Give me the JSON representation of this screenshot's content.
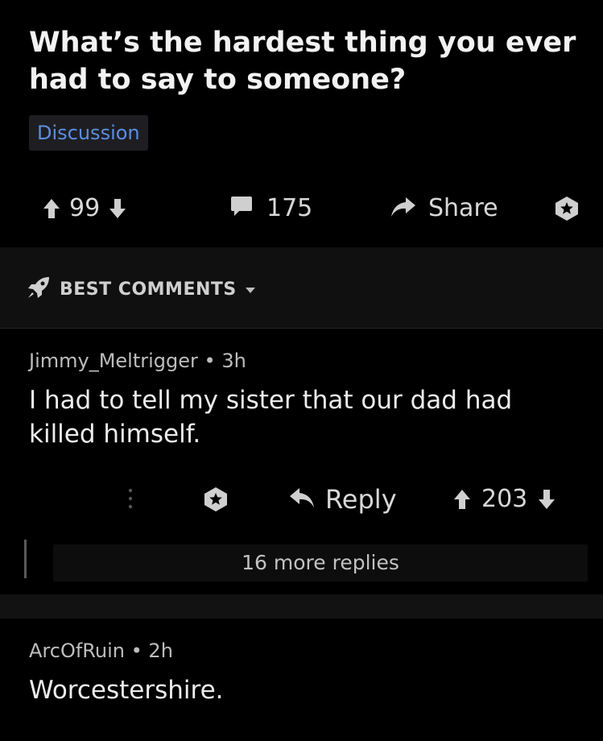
{
  "post": {
    "title": "What’s the hardest thing you ever had to say to someone?",
    "flair": "Discussion",
    "score": "99",
    "comment_count": "175",
    "share_label": "Share"
  },
  "sort": {
    "label": "BEST COMMENTS"
  },
  "comments": [
    {
      "author": "Jimmy_Meltrigger",
      "separator": "•",
      "age": "3h",
      "body": "I had to tell my sister that our dad had killed himself.",
      "reply_label": "Reply",
      "score": "203",
      "more_replies": "16 more replies"
    },
    {
      "author": "ArcOfRuin",
      "separator": "•",
      "age": "2h",
      "body": "Worcestershire."
    }
  ],
  "icons": {
    "upvote": "upvote-arrow-icon",
    "downvote": "downvote-arrow-icon",
    "comment": "comment-bubble-icon",
    "share": "share-arrow-icon",
    "award": "award-icon",
    "sort": "rocket-icon",
    "caret": "caret-down-icon",
    "more": "more-options-icon",
    "reply": "reply-arrow-icon"
  },
  "colors": {
    "background": "#000000",
    "flair_text": "#5b8ee0",
    "text": "#e6e6e6"
  }
}
